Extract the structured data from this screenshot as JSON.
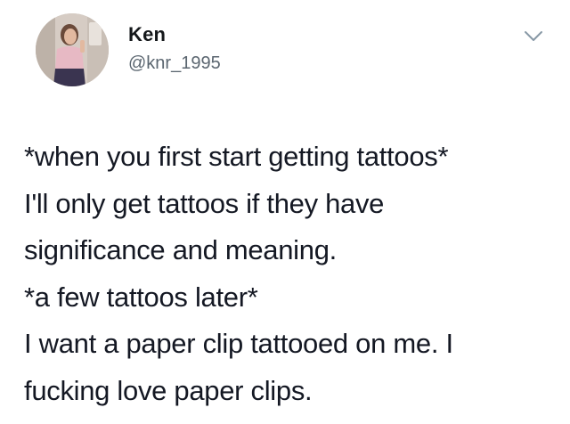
{
  "user": {
    "display_name": "Ken",
    "handle": "@knr_1995",
    "avatar_icon": "profile-photo"
  },
  "menu": {
    "icon": "chevron-down-icon"
  },
  "tweet": {
    "lines": [
      "*when you first start getting tattoos*",
      "I'll only get tattoos if they have",
      "significance and meaning.",
      "*a few tattoos later*",
      "I want a paper clip tattooed on me. I",
      "fucking love paper clips."
    ]
  },
  "colors": {
    "text": "#14171a",
    "secondary_text": "#5b6670",
    "chevron": "#8899a6",
    "background": "#ffffff"
  }
}
